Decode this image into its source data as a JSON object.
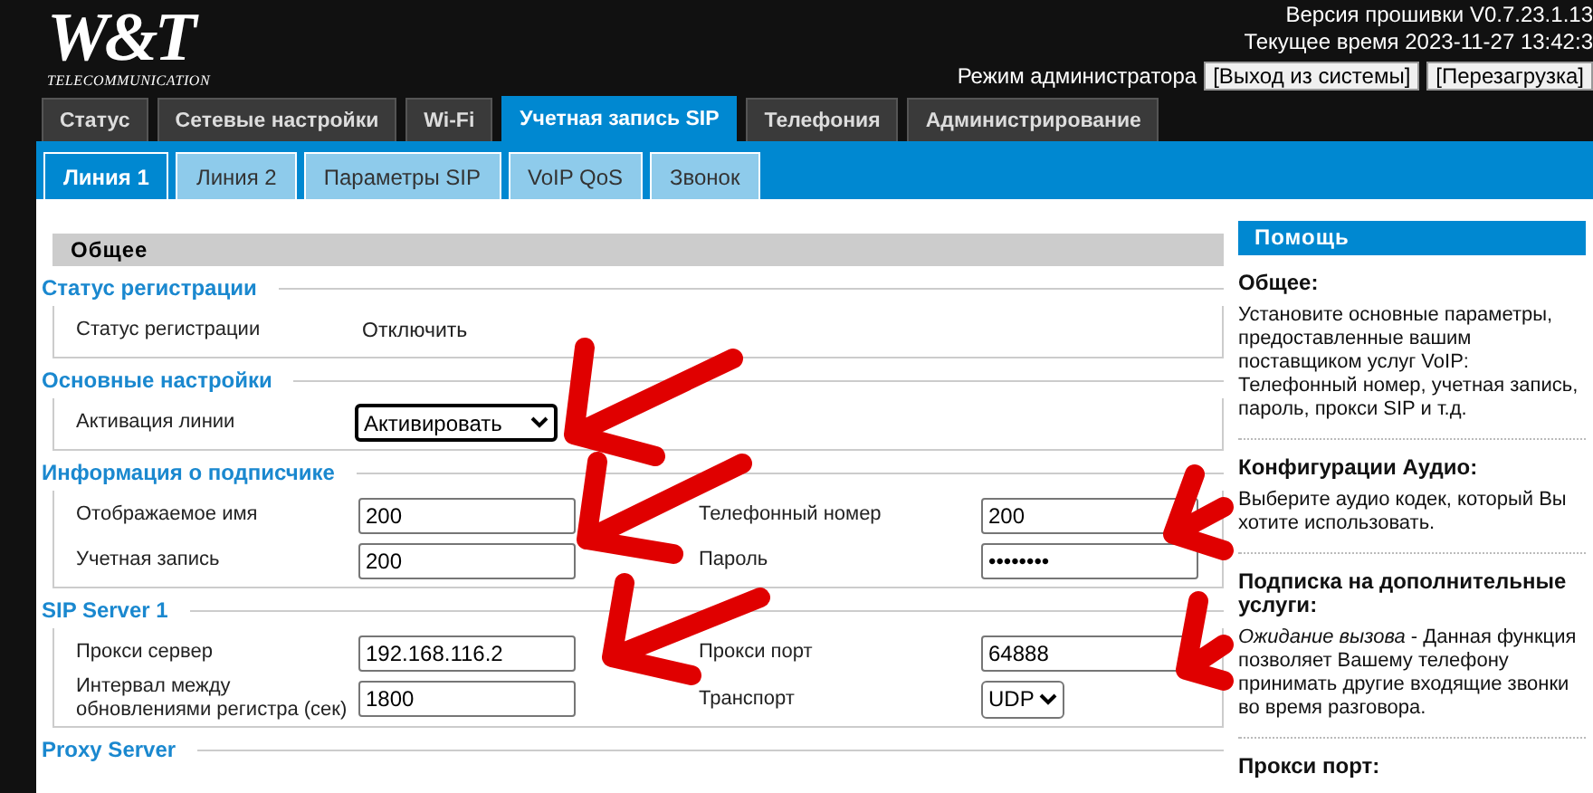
{
  "logo": {
    "mark": "W&T",
    "tagline": "TELECOMMUNICATION"
  },
  "header": {
    "firmware": "Версия прошивки V0.7.23.1.13",
    "time": "Текущее время 2023-11-27 13:42:3",
    "mode": "Режим администратора",
    "buttons": [
      "[Выход из системы]",
      "[Перезагрузка]"
    ]
  },
  "tabs": [
    {
      "label": "Статус",
      "selected": false
    },
    {
      "label": "Сетевые настройки",
      "selected": false
    },
    {
      "label": "Wi-Fi",
      "selected": false
    },
    {
      "label": "Учетная запись SIP",
      "selected": true
    },
    {
      "label": "Телефония",
      "selected": false
    },
    {
      "label": "Администрирование",
      "selected": false
    }
  ],
  "subtabs": [
    {
      "label": "Линия 1",
      "selected": true
    },
    {
      "label": "Линия 2",
      "selected": false
    },
    {
      "label": "Параметры SIP",
      "selected": false
    },
    {
      "label": "VoIP QoS",
      "selected": false
    },
    {
      "label": "Звонок",
      "selected": false
    }
  ],
  "panel_title": "Общее",
  "sections": [
    {
      "title": "Статус регистрации",
      "rows": [
        [
          {
            "label": "Статус регистрации",
            "kind": "text",
            "value": "Отключить"
          }
        ]
      ]
    },
    {
      "title": "Основные настройки",
      "rows": [
        [
          {
            "label": "Активация линии",
            "kind": "select",
            "value": "Активировать"
          }
        ]
      ]
    },
    {
      "title": "Информация о подписчике",
      "rows": [
        [
          {
            "label": "Отображаемое имя",
            "kind": "input",
            "value": "200"
          },
          {
            "label": "Телефонный номер",
            "kind": "input",
            "value": "200"
          }
        ],
        [
          {
            "label": "Учетная запись",
            "kind": "input",
            "value": "200"
          },
          {
            "label": "Пароль",
            "kind": "password",
            "value": "••••••••"
          }
        ]
      ]
    },
    {
      "title": "SIP Server 1",
      "rows": [
        [
          {
            "label": "Прокси сервер",
            "kind": "input",
            "value": "192.168.116.2"
          },
          {
            "label": "Прокси порт",
            "kind": "input",
            "value": "64888"
          }
        ],
        [
          {
            "label": "Интервал между обновлениями регистра (сек)",
            "kind": "input",
            "value": "1800"
          },
          {
            "label": "Транспорт",
            "kind": "select-small",
            "value": "UDP"
          }
        ]
      ]
    },
    {
      "title": "Proxy Server"
    }
  ],
  "help": {
    "title": "Помощь",
    "items": [
      {
        "heading": "Общее:",
        "text": "Установите основные параметры, предоставленные вашим поставщиком услуг VoIP: Телефонный номер, учетная запись, пароль, прокси SIP и т.д."
      },
      {
        "heading": "Конфигурации Аудио:",
        "text": "Выберите аудио кодек, который Вы хотите использовать."
      },
      {
        "heading": "Подписка на дополнительные услуги:",
        "text": "*Ожидание вызова* - Данная функция позволяет Вашему телефону принимать другие входящие звонки во время разговора."
      },
      {
        "heading": "Прокси порт:"
      }
    ]
  }
}
